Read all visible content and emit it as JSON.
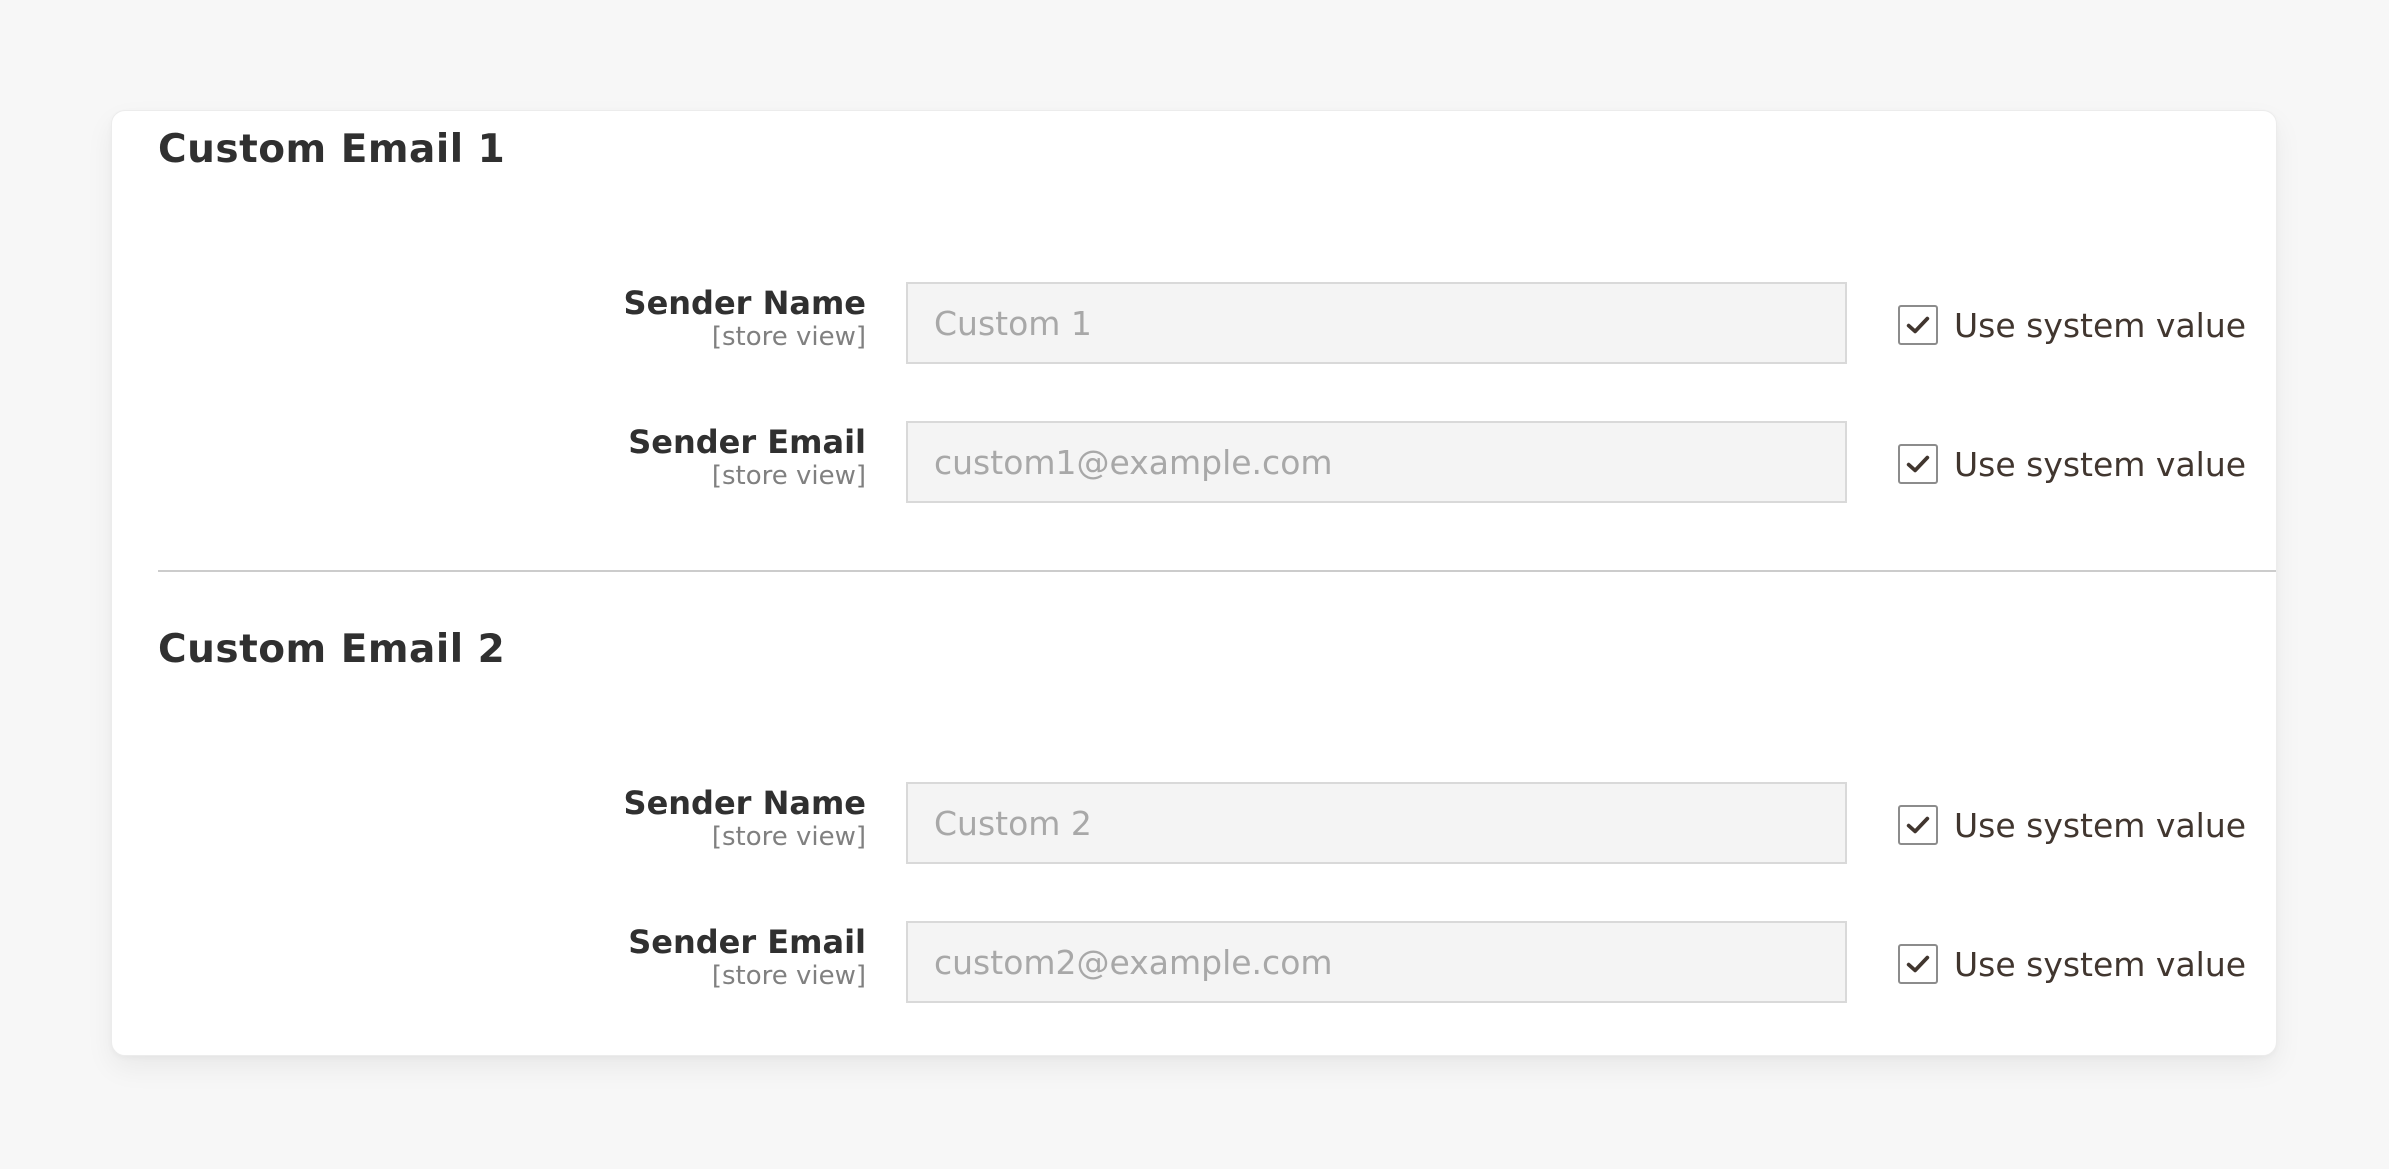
{
  "sections": [
    {
      "title": "Custom Email 1",
      "fields": [
        {
          "label": "Sender Name",
          "scope": "[store view]",
          "value": "Custom 1",
          "disabled": true,
          "use_system_value": {
            "label": "Use system value",
            "checked": true,
            "icon": "check-icon"
          }
        },
        {
          "label": "Sender Email",
          "scope": "[store view]",
          "value": "custom1@example.com",
          "disabled": true,
          "use_system_value": {
            "label": "Use system value",
            "checked": true,
            "icon": "check-icon"
          }
        }
      ]
    },
    {
      "title": "Custom Email 2",
      "fields": [
        {
          "label": "Sender Name",
          "scope": "[store view]",
          "value": "Custom 2",
          "disabled": true,
          "use_system_value": {
            "label": "Use system value",
            "checked": true,
            "icon": "check-icon"
          }
        },
        {
          "label": "Sender Email",
          "scope": "[store view]",
          "value": "custom2@example.com",
          "disabled": true,
          "use_system_value": {
            "label": "Use system value",
            "checked": true,
            "icon": "check-icon"
          }
        }
      ]
    }
  ],
  "colors": {
    "page_background": "#f7f7f7",
    "card_background": "#ffffff",
    "input_background": "#f4f4f4",
    "input_text": "#a8a8a8",
    "label_text": "#303030",
    "divider": "#cccccc"
  }
}
